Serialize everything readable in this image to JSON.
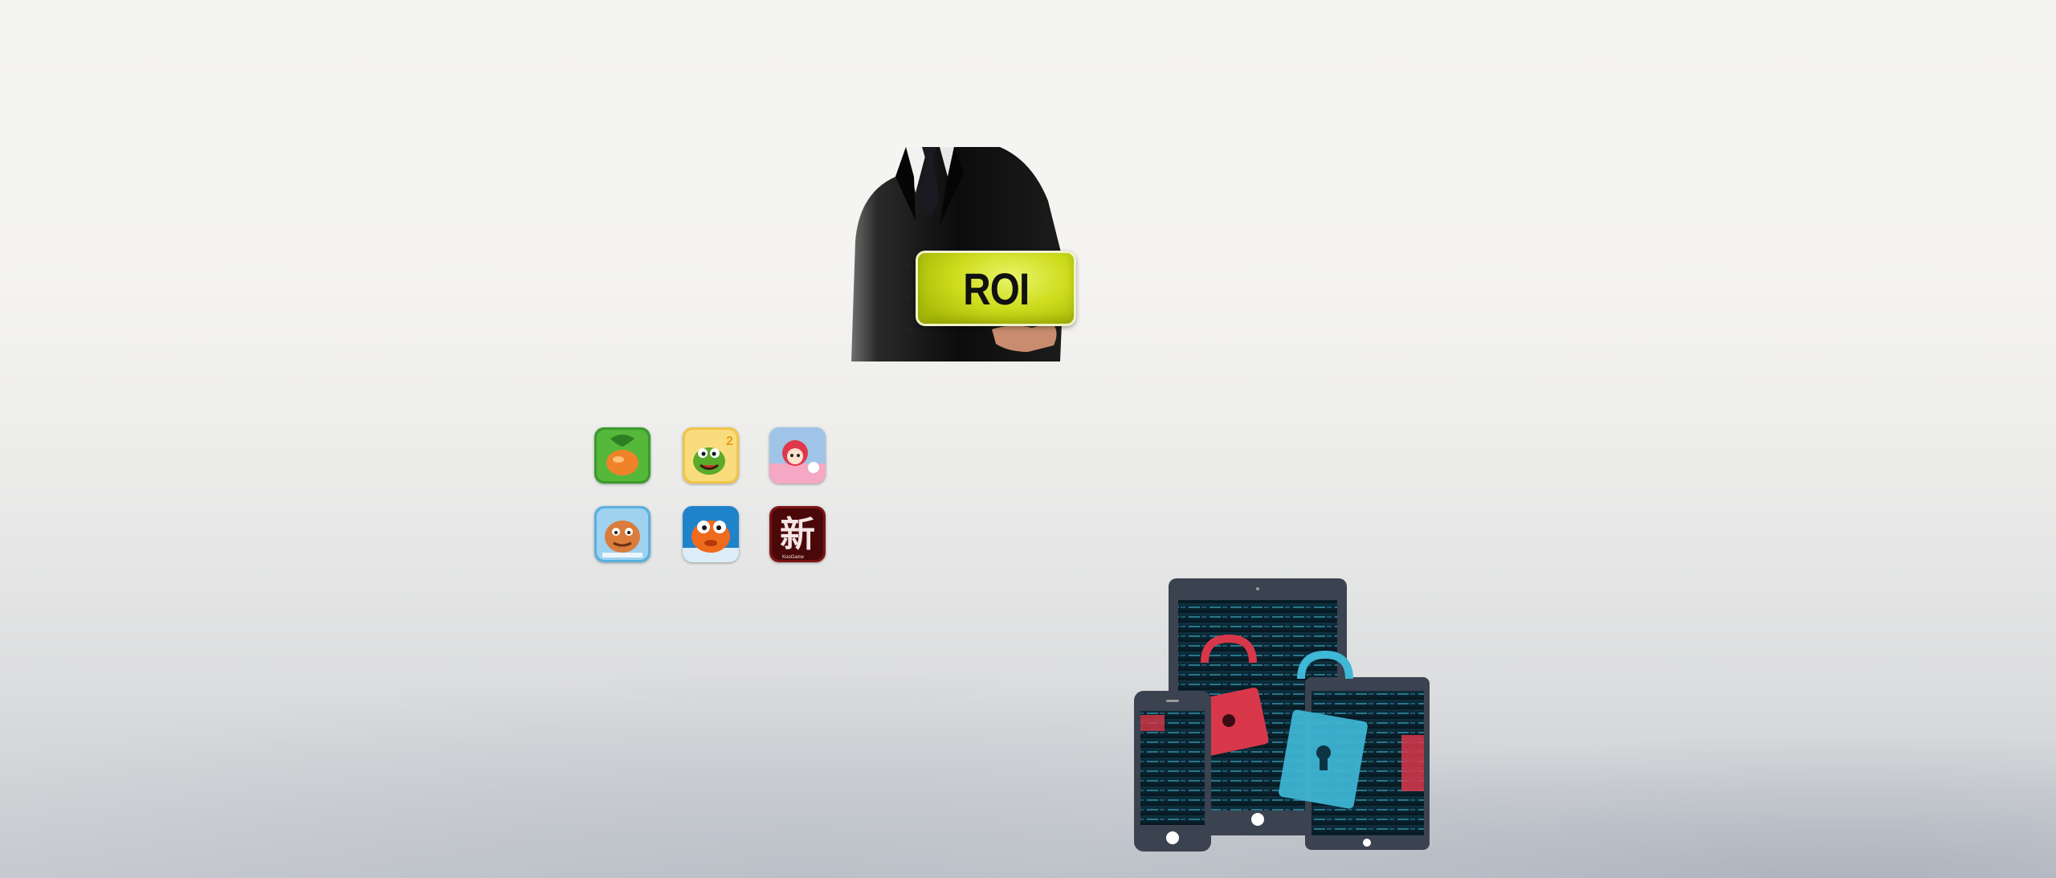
{
  "hero": {
    "button_label": "ROI"
  },
  "game_icons": [
    {
      "name": "carrot-game-icon",
      "accent": "#3c9a2c"
    },
    {
      "name": "om-nom-game-icon",
      "accent": "#f1c44a",
      "badge": "2"
    },
    {
      "name": "anime-girl-game-icon",
      "accent": "#9fc4e8"
    },
    {
      "name": "dragon-game-icon",
      "accent": "#d97c3c"
    },
    {
      "name": "orange-fish-game-icon",
      "accent": "#1f83c9"
    },
    {
      "name": "xin-calligraphy-game-icon",
      "accent": "#7a1414",
      "glyph": "新",
      "caption": "KooGame"
    }
  ],
  "devices": {
    "description_icons": [
      "tablet-icon",
      "phone-icon",
      "mini-tablet-icon",
      "padlock-icon"
    ],
    "screen_code_color": "#3fb7d6",
    "lock_colors": [
      "#d8374a",
      "#3fb7d6"
    ]
  }
}
